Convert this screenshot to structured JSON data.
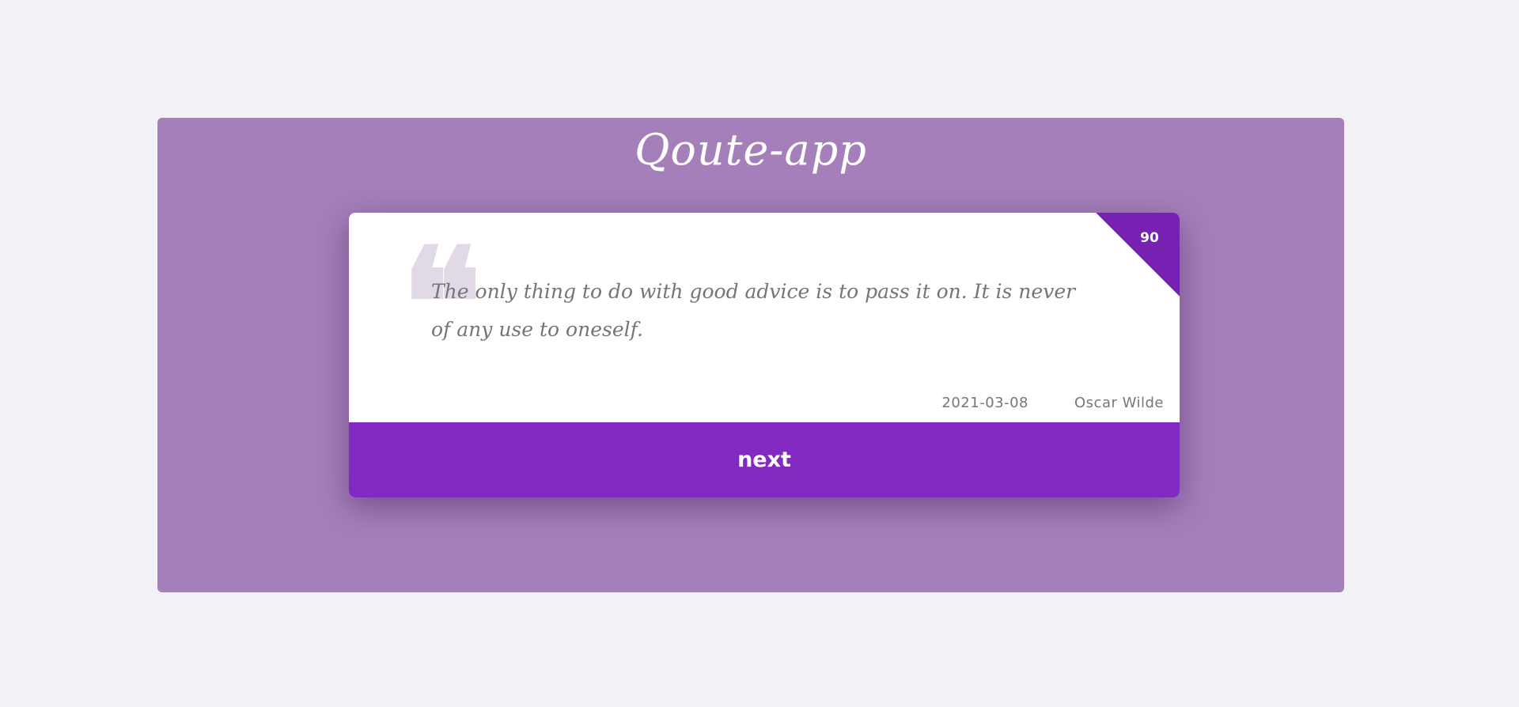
{
  "app": {
    "title": "Qoute-app"
  },
  "quote": {
    "id": "90",
    "text": "The only thing to do with good advice is to pass it on. It is never of any use to oneself.",
    "date": "2021-03-08",
    "author": "Oscar Wilde"
  },
  "actions": {
    "next_label": "next"
  },
  "colors": {
    "page_background": "#f2f1f6",
    "panel_background": "#a47fba",
    "card_background": "#ffffff",
    "accent": "#8129c0",
    "corner_badge": "#7621b2",
    "quote_mark": "#e2d9e7",
    "text_muted": "#757575"
  },
  "icons": {
    "quote_mark": "left-double-quote-icon"
  }
}
